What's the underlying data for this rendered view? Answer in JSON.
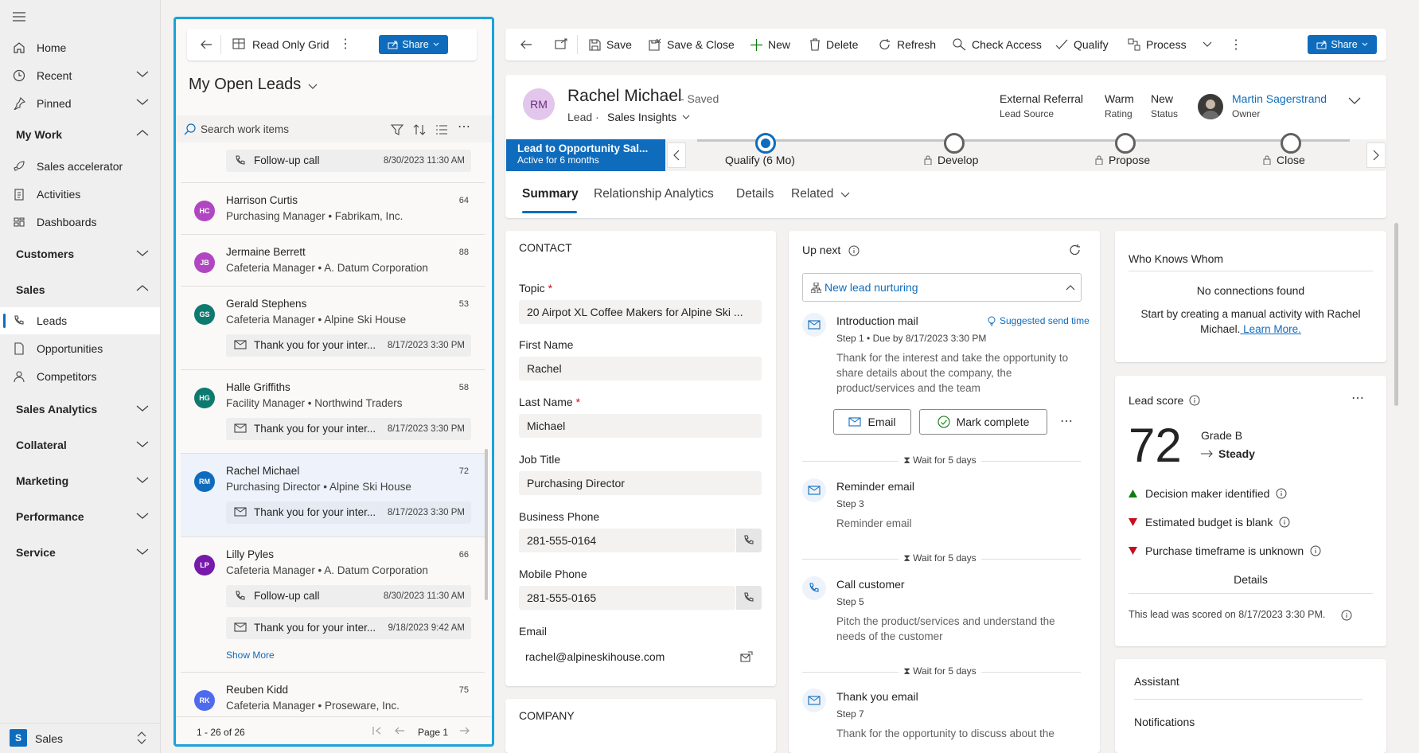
{
  "sidebar": {
    "app_name": "Sales",
    "app_initial": "S",
    "items": [
      {
        "label": "Home",
        "icon": "home-icon"
      },
      {
        "label": "Recent",
        "icon": "clock-icon"
      },
      {
        "label": "Pinned",
        "icon": "pin-icon"
      }
    ],
    "groups": {
      "my_work": "My Work",
      "customers": "Customers",
      "sales": "Sales",
      "sales_analytics": "Sales Analytics",
      "collateral": "Collateral",
      "marketing": "Marketing",
      "performance": "Performance",
      "service": "Service"
    },
    "my_work_items": [
      {
        "label": "Sales accelerator",
        "icon": "rocket-icon"
      },
      {
        "label": "Activities",
        "icon": "clipboard-icon"
      },
      {
        "label": "Dashboards",
        "icon": "dashboard-icon"
      }
    ],
    "sales_items": [
      {
        "label": "Leads",
        "icon": "phone-leads-icon"
      },
      {
        "label": "Opportunities",
        "icon": "document-icon"
      },
      {
        "label": "Competitors",
        "icon": "person-icon"
      }
    ]
  },
  "list": {
    "grid_label": "Read Only Grid",
    "share_label": "Share",
    "view_title": "My Open Leads",
    "search_placeholder": "Search work items",
    "top_activity": {
      "text": "Follow-up call",
      "date": "8/30/2023 11:30 AM"
    },
    "leads": [
      {
        "initials": "HC",
        "name": "Harrison Curtis",
        "subtitle": "Purchasing Manager • Fabrikam, Inc.",
        "score": "64",
        "color": "#b146c2"
      },
      {
        "initials": "JB",
        "name": "Jermaine Berrett",
        "subtitle": "Cafeteria Manager • A. Datum Corporation",
        "score": "88",
        "color": "#b146c2"
      },
      {
        "initials": "GS",
        "name": "Gerald Stephens",
        "subtitle": "Cafeteria Manager • Alpine Ski House",
        "score": "53",
        "color": "#0e7a6f",
        "activity": {
          "text": "Thank you for your inter...",
          "date": "8/17/2023 3:30 PM"
        }
      },
      {
        "initials": "HG",
        "name": "Halle Griffiths",
        "subtitle": "Facility Manager • Northwind Traders",
        "score": "58",
        "color": "#0e7a6f",
        "activity": {
          "text": "Thank you for your inter...",
          "date": "8/17/2023 3:30 PM"
        }
      },
      {
        "initials": "RM",
        "name": "Rachel Michael",
        "subtitle": "Purchasing Director • Alpine Ski House",
        "score": "72",
        "color": "#0f6cbd",
        "activity": {
          "text": "Thank you for your inter...",
          "date": "8/17/2023 3:30 PM"
        }
      },
      {
        "initials": "LP",
        "name": "Lilly Pyles",
        "subtitle": "Cafeteria Manager • A. Datum Corporation",
        "score": "66",
        "color": "#7719aa",
        "activity": {
          "text": "Follow-up call",
          "date": "8/30/2023 11:30 AM"
        },
        "activity2": {
          "text": "Thank you for your inter...",
          "date": "9/18/2023 9:42 AM"
        },
        "show_more": "Show More"
      },
      {
        "initials": "RK",
        "name": "Reuben Kidd",
        "subtitle": "Cafeteria Manager • Proseware, Inc.",
        "score": "75",
        "color": "#4f6bed"
      }
    ],
    "pagination": {
      "range": "1 - 26 of 26",
      "page": "Page 1"
    }
  },
  "toolbar": {
    "save": "Save",
    "save_close": "Save & Close",
    "new": "New",
    "delete": "Delete",
    "refresh": "Refresh",
    "check_access": "Check Access",
    "qualify": "Qualify",
    "process": "Process",
    "share": "Share"
  },
  "header": {
    "initials": "RM",
    "name": "Rachel Michael",
    "saved": "- Saved",
    "entity": "Lead",
    "form": "Sales Insights",
    "fields": [
      {
        "value": "External Referral",
        "label": "Lead Source"
      },
      {
        "value": "Warm",
        "label": "Rating"
      },
      {
        "value": "New",
        "label": "Status"
      }
    ],
    "owner": {
      "name": "Martin Sagerstrand",
      "label": "Owner"
    }
  },
  "bpf": {
    "process_name": "Lead to Opportunity Sal...",
    "active_for": "Active for 6 months",
    "stages": [
      "Qualify  (6 Mo)",
      "Develop",
      "Propose",
      "Close"
    ]
  },
  "tabs": [
    "Summary",
    "Relationship Analytics",
    "Details",
    "Related"
  ],
  "contact": {
    "section": "CONTACT",
    "topic_label": "Topic",
    "topic": "20 Airpot XL Coffee Makers for Alpine Ski ...",
    "first_label": "First Name",
    "first": "Rachel",
    "last_label": "Last Name",
    "last": "Michael",
    "job_label": "Job Title",
    "job": "Purchasing Director",
    "bphone_label": "Business Phone",
    "bphone": "281-555-0164",
    "mphone_label": "Mobile Phone",
    "mphone": "281-555-0165",
    "email_label": "Email",
    "email": "rachel@alpineskihouse.com",
    "company_section": "COMPANY"
  },
  "upnext": {
    "title": "Up next",
    "sequence": "New lead nurturing",
    "steps": [
      {
        "title": "Introduction mail",
        "sub": "Step 1 • Due by 8/17/2023 3:30 PM",
        "body": "Thank for the interest and take the opportunity to share details about the company, the product/services and the team",
        "suggest": "Suggested send time"
      },
      {
        "title": "Reminder email",
        "sub": "Step 3",
        "body": "Reminder email"
      },
      {
        "title": "Call customer",
        "sub": "Step 5",
        "body": "Pitch the product/services and understand the needs of the customer"
      },
      {
        "title": "Thank you email",
        "sub": "Step 7",
        "body": "Thank for the opportunity to discuss about  the"
      }
    ],
    "email_btn": "Email",
    "complete_btn": "Mark complete",
    "wait": "Wait for 5 days"
  },
  "who_knows": {
    "title": "Who Knows Whom",
    "none": "No connections found",
    "hint": "Start by creating a manual activity with Rachel Michael.",
    "learn": " Learn More."
  },
  "lead_score": {
    "title": "Lead score",
    "score": "72",
    "grade": "Grade B",
    "trend": "Steady",
    "reasons": [
      {
        "text": "Decision maker identified",
        "dir": "up"
      },
      {
        "text": "Estimated budget is blank",
        "dir": "down"
      },
      {
        "text": "Purchase timeframe is unknown",
        "dir": "down"
      }
    ],
    "details": "Details",
    "scored": "This lead was scored on 8/17/2023 3:30 PM."
  },
  "assistant": {
    "title": "Assistant",
    "notifications": "Notifications"
  },
  "colors": {
    "accent": "#0f6cbd",
    "frame": "#1aa3d9",
    "bpf_active": "#0f6cbd"
  }
}
